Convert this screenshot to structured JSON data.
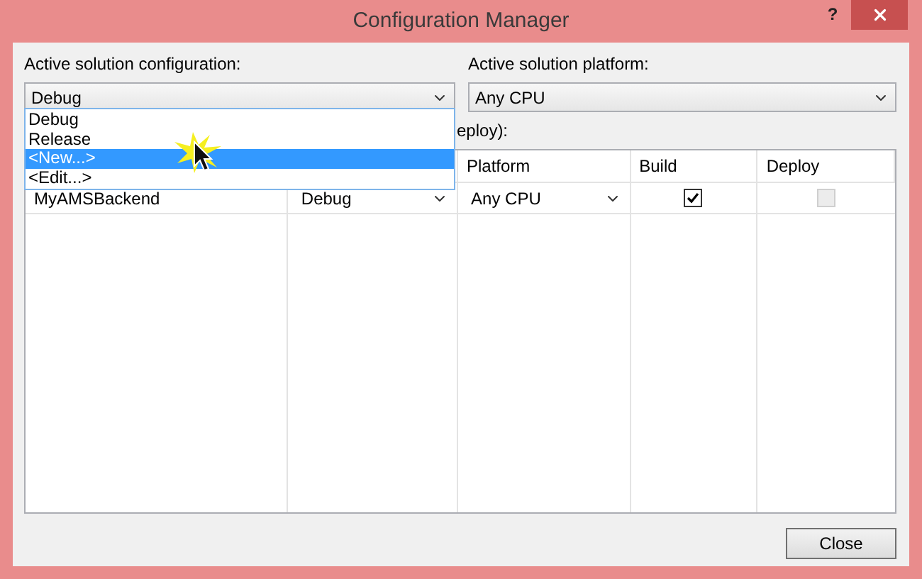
{
  "window": {
    "title": "Configuration Manager",
    "help": "?"
  },
  "configuration": {
    "label": "Active solution configuration:",
    "value": "Debug",
    "expanded": true,
    "options": [
      {
        "label": "Debug",
        "highlighted": false
      },
      {
        "label": "Release",
        "highlighted": false
      },
      {
        "label": "<New...>",
        "highlighted": true
      },
      {
        "label": "<Edit...>",
        "highlighted": false
      }
    ]
  },
  "platform": {
    "label": "Active solution platform:",
    "value": "Any CPU"
  },
  "contexts_label": "eploy):",
  "table": {
    "columns": [
      "Platform",
      "Build",
      "Deploy"
    ],
    "rows": [
      {
        "project": "MyAMSBackend",
        "configuration": "Debug",
        "platform": "Any CPU",
        "build": true,
        "deploy": false
      }
    ]
  },
  "buttons": [
    "Close"
  ]
}
